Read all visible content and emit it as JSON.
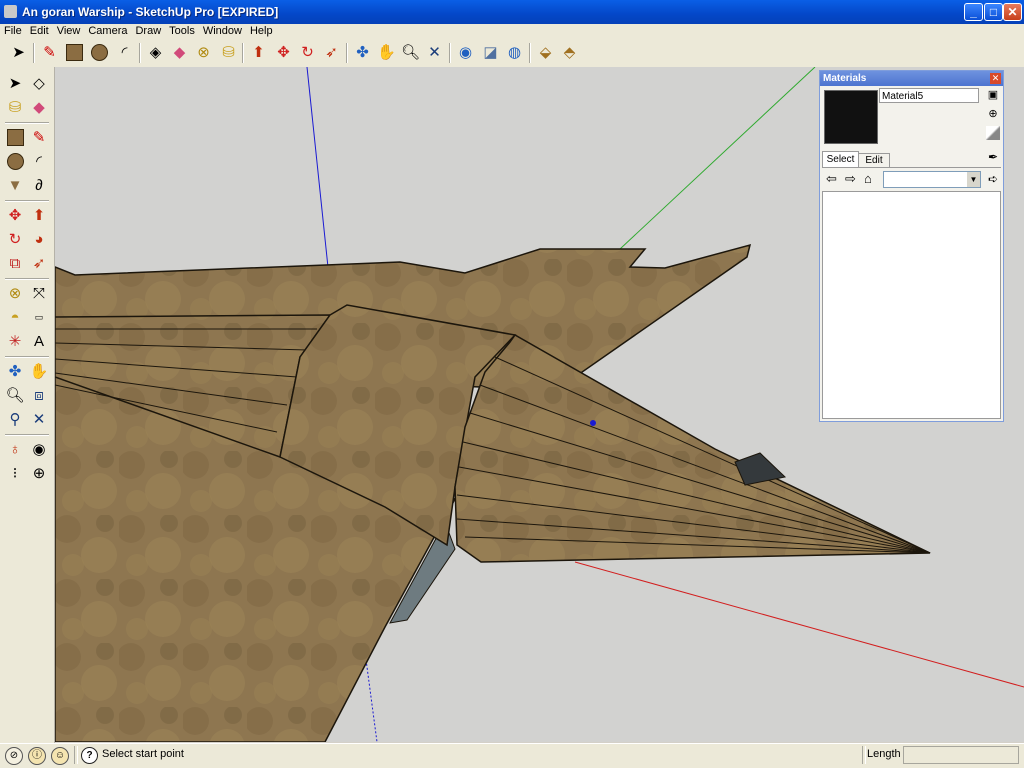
{
  "window": {
    "title": "An goran Warship - SketchUp Pro [EXPIRED]",
    "buttons": {
      "minimize": "_",
      "maximize": "□",
      "close": "✕"
    }
  },
  "menu": [
    "File",
    "Edit",
    "View",
    "Camera",
    "Draw",
    "Tools",
    "Window",
    "Help"
  ],
  "toolbar": {
    "icons": [
      "select-icon",
      "line-icon",
      "rectangle-icon",
      "circle-icon",
      "arc-icon",
      "make-component-icon",
      "eraser-icon",
      "tape-measure-icon",
      "paint-bucket-icon",
      "push-pull-icon",
      "move-icon",
      "rotate-icon",
      "follow-me-icon",
      "orbit-icon",
      "pan-icon",
      "zoom-icon",
      "zoom-extents-icon",
      "previous-view-icon",
      "next-view-icon",
      "standard-views-icon",
      "get-models-icon",
      "share-model-icon"
    ]
  },
  "left_toolbar": {
    "icons": [
      "select-icon",
      "make-component-icon",
      "paint-bucket-icon",
      "eraser-icon",
      "rectangle-icon",
      "line-icon",
      "circle-icon",
      "arc-icon",
      "polygon-icon",
      "freehand-icon",
      "move-icon",
      "push-pull-icon",
      "rotate-icon",
      "follow-me-icon",
      "scale-icon",
      "offset-icon",
      "tape-measure-icon",
      "dimension-icon",
      "protractor-icon",
      "text-icon",
      "axes-icon",
      "3d-text-icon",
      "orbit-icon",
      "pan-icon",
      "zoom-icon",
      "zoom-window-icon",
      "previous-icon",
      "zoom-extents-icon",
      "position-camera-icon",
      "look-around-icon",
      "walk-icon",
      "section-plane-icon"
    ]
  },
  "materials": {
    "title": "Materials",
    "material_name": "Material5",
    "tabs": [
      "Select",
      "Edit"
    ],
    "dropdown_value": ""
  },
  "status": {
    "message": "Select start point",
    "measurement_label": "Length",
    "measurement_value": ""
  },
  "colors": {
    "title_blue": "#0a5fe6",
    "model_fill": "#8b7450",
    "axis_red": "#d21e1e",
    "axis_green": "#2faa2f",
    "axis_blue": "#1a1ad2"
  }
}
